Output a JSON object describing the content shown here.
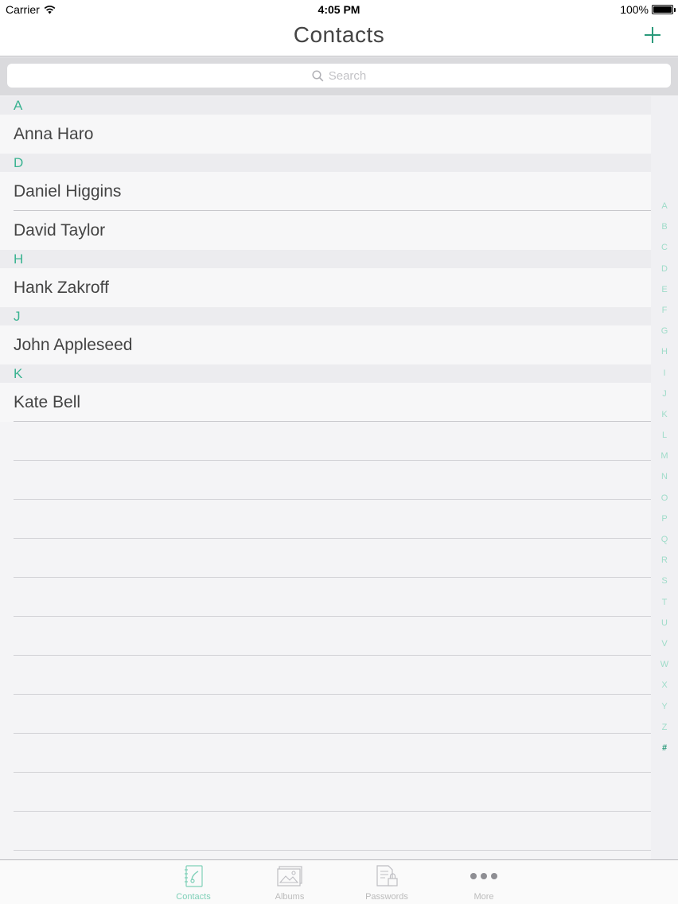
{
  "status_bar": {
    "carrier": "Carrier",
    "time": "4:05 PM",
    "battery": "100%"
  },
  "nav": {
    "title": "Contacts",
    "add_icon": "plus-icon"
  },
  "search": {
    "placeholder": "Search",
    "icon": "search-icon"
  },
  "sections": [
    {
      "letter": "A",
      "contacts": [
        "Anna Haro"
      ]
    },
    {
      "letter": "D",
      "contacts": [
        "Daniel Higgins",
        "David Taylor"
      ]
    },
    {
      "letter": "H",
      "contacts": [
        "Hank Zakroff"
      ]
    },
    {
      "letter": "J",
      "contacts": [
        "John Appleseed"
      ]
    },
    {
      "letter": "K",
      "contacts": [
        "Kate Bell"
      ]
    }
  ],
  "index_letters": [
    "A",
    "B",
    "C",
    "D",
    "E",
    "F",
    "G",
    "H",
    "I",
    "J",
    "K",
    "L",
    "M",
    "N",
    "O",
    "P",
    "Q",
    "R",
    "S",
    "T",
    "U",
    "V",
    "W",
    "X",
    "Y",
    "Z",
    "#"
  ],
  "tabs": [
    {
      "label": "Contacts",
      "icon": "contacts-book-icon",
      "active": true
    },
    {
      "label": "Albums",
      "icon": "photo-album-icon",
      "active": false
    },
    {
      "label": "Passwords",
      "icon": "password-document-icon",
      "active": false
    },
    {
      "label": "More",
      "icon": "more-dots-icon",
      "active": false
    }
  ],
  "colors": {
    "accent": "#2a9a7a",
    "section_letter": "#3ab391",
    "index_letter": "#9fdcc9"
  }
}
